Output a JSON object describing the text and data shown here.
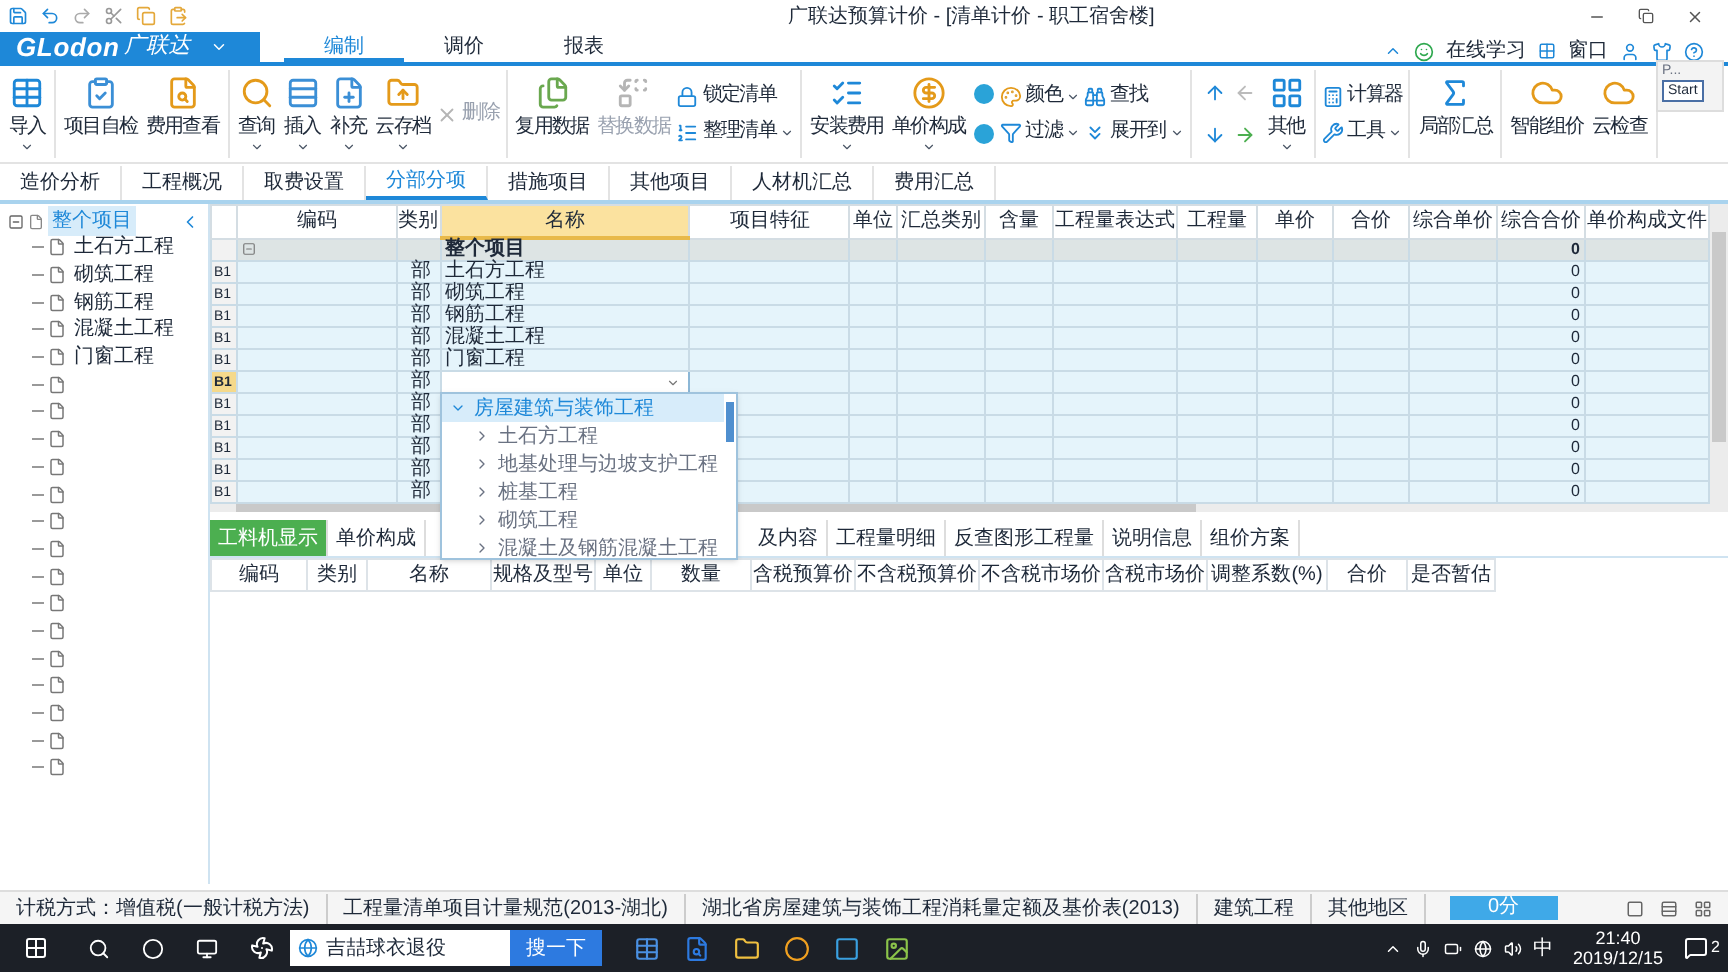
{
  "window": {
    "title": "广联达预算计价 - [清单计价 - 职工宿舍楼]"
  },
  "brand": {
    "logo": "GLodon",
    "name": "广联达"
  },
  "menu": [
    {
      "label": "编制",
      "selected": true
    },
    {
      "label": "调价",
      "selected": false
    },
    {
      "label": "报表",
      "selected": false
    }
  ],
  "help_links": [
    {
      "label": "在线学习"
    },
    {
      "label": "窗口"
    }
  ],
  "recorder": {
    "label": "P...",
    "button": "Start"
  },
  "ribbon": [
    {
      "items": [
        {
          "kind": "large",
          "label": "导入",
          "dropdown": true,
          "disabled": false
        }
      ]
    },
    {
      "items": [
        {
          "kind": "large",
          "label": "项目自检",
          "dropdown": false,
          "disabled": false
        },
        {
          "kind": "large",
          "label": "费用查看",
          "dropdown": false,
          "disabled": false
        }
      ]
    },
    {
      "items": [
        {
          "kind": "large",
          "label": "查询",
          "dropdown": true,
          "disabled": false
        },
        {
          "kind": "large",
          "label": "插入",
          "dropdown": true,
          "disabled": false
        },
        {
          "kind": "large",
          "label": "补充",
          "dropdown": true,
          "disabled": false
        },
        {
          "kind": "large",
          "label": "云存档",
          "dropdown": true,
          "disabled": false
        },
        {
          "kind": "small",
          "label": "删除",
          "dropdown": false,
          "disabled": true
        }
      ]
    },
    {
      "items": [
        {
          "kind": "large",
          "label": "复用数据",
          "dropdown": false,
          "disabled": false
        },
        {
          "kind": "large",
          "label": "替换数据",
          "dropdown": false,
          "disabled": true
        },
        {
          "kind": "small",
          "label": "锁定清单",
          "dropdown": false,
          "disabled": false
        },
        {
          "kind": "small",
          "label": "整理清单",
          "dropdown": true,
          "disabled": false
        }
      ]
    },
    {
      "items": [
        {
          "kind": "large",
          "label": "安装费用",
          "dropdown": true,
          "disabled": false
        },
        {
          "kind": "large",
          "label": "单价构成",
          "dropdown": true,
          "disabled": false
        },
        {
          "kind": "circles"
        },
        {
          "kind": "small",
          "label": "颜色",
          "dropdown": true,
          "disabled": false
        },
        {
          "kind": "small",
          "label": "过滤",
          "dropdown": true,
          "disabled": false
        },
        {
          "kind": "small",
          "label": "查找",
          "dropdown": false,
          "disabled": false
        },
        {
          "kind": "small",
          "label": "展开到",
          "dropdown": true,
          "disabled": false
        }
      ]
    },
    {
      "items": [
        {
          "kind": "arrows"
        },
        {
          "kind": "large",
          "label": "其他",
          "dropdown": true,
          "disabled": false
        }
      ]
    },
    {
      "items": [
        {
          "kind": "small",
          "label": "计算器",
          "dropdown": false,
          "disabled": false
        },
        {
          "kind": "small",
          "label": "工具",
          "dropdown": true,
          "disabled": false
        }
      ]
    },
    {
      "items": [
        {
          "kind": "large",
          "label": "局部汇总",
          "dropdown": false,
          "disabled": false
        }
      ]
    },
    {
      "items": [
        {
          "kind": "large",
          "label": "智能组价",
          "dropdown": false,
          "disabled": false
        },
        {
          "kind": "large",
          "label": "云检查",
          "dropdown": false,
          "disabled": false
        }
      ]
    }
  ],
  "view_tabs": [
    {
      "label": "造价分析",
      "selected": false
    },
    {
      "label": "工程概况",
      "selected": false
    },
    {
      "label": "取费设置",
      "selected": false
    },
    {
      "label": "分部分项",
      "selected": true
    },
    {
      "label": "措施项目",
      "selected": false
    },
    {
      "label": "其他项目",
      "selected": false
    },
    {
      "label": "人材机汇总",
      "selected": false
    },
    {
      "label": "费用汇总",
      "selected": false
    }
  ],
  "tree": {
    "label": "整个项目",
    "expanded": true,
    "selected": true,
    "children": [
      {
        "kind": "named",
        "label": "土石方工程"
      },
      {
        "kind": "named",
        "label": "砌筑工程"
      },
      {
        "kind": "named",
        "label": "钢筋工程"
      },
      {
        "kind": "named",
        "label": "混凝土工程"
      },
      {
        "kind": "named",
        "label": "门窗工程"
      },
      {
        "kind": "blank"
      },
      {
        "kind": "blank"
      },
      {
        "kind": "blank"
      },
      {
        "kind": "blank"
      },
      {
        "kind": "blank"
      },
      {
        "kind": "blank"
      },
      {
        "kind": "blank"
      },
      {
        "kind": "blank"
      },
      {
        "kind": "blank"
      },
      {
        "kind": "blank"
      },
      {
        "kind": "blank"
      },
      {
        "kind": "blank"
      },
      {
        "kind": "blank"
      },
      {
        "kind": "blank"
      },
      {
        "kind": "blank"
      }
    ]
  },
  "table": {
    "columns": [
      {
        "label": "编码",
        "selected": false
      },
      {
        "label": "类别",
        "selected": false
      },
      {
        "label": "名称",
        "selected": true
      },
      {
        "label": "项目特征",
        "selected": false
      },
      {
        "label": "单位",
        "selected": false
      },
      {
        "label": "汇总类别",
        "selected": false
      },
      {
        "label": "含量",
        "selected": false
      },
      {
        "label": "工程量表达式",
        "selected": false
      },
      {
        "label": "工程量",
        "selected": false
      },
      {
        "label": "单价",
        "selected": false
      },
      {
        "label": "合价",
        "selected": false
      },
      {
        "label": "综合单价",
        "selected": false
      },
      {
        "label": "综合合价",
        "selected": false
      },
      {
        "label": "单价构成文件",
        "selected": false
      }
    ],
    "rows": [
      {
        "kind": "summary",
        "name": "整个项目",
        "total": "0",
        "selected": false
      },
      {
        "kind": "part",
        "marker": "B1",
        "category": "部",
        "name": "土石方工程",
        "total": "0",
        "selected": false
      },
      {
        "kind": "part",
        "marker": "B1",
        "category": "部",
        "name": "砌筑工程",
        "total": "0",
        "selected": false
      },
      {
        "kind": "part",
        "marker": "B1",
        "category": "部",
        "name": "钢筋工程",
        "total": "0",
        "selected": false
      },
      {
        "kind": "part",
        "marker": "B1",
        "category": "部",
        "name": "混凝土工程",
        "total": "0",
        "selected": false
      },
      {
        "kind": "part",
        "marker": "B1",
        "category": "部",
        "name": "门窗工程",
        "total": "0",
        "selected": false
      },
      {
        "kind": "part",
        "marker": "B1",
        "category": "部",
        "total": "0",
        "selected": true
      },
      {
        "kind": "part",
        "marker": "B1",
        "category": "部",
        "total": "0",
        "selected": false
      },
      {
        "kind": "part",
        "marker": "B1",
        "category": "部",
        "total": "0",
        "selected": false
      },
      {
        "kind": "part",
        "marker": "B1",
        "category": "部",
        "total": "0",
        "selected": false
      },
      {
        "kind": "part",
        "marker": "B1",
        "category": "部",
        "total": "0",
        "selected": false
      },
      {
        "kind": "part",
        "marker": "B1",
        "category": "部",
        "total": "0",
        "selected": false
      }
    ]
  },
  "name_dropdown": {
    "items": [
      {
        "label": "房屋建筑与装饰工程",
        "expanded": true,
        "selected": true,
        "children": [
          {
            "label": "土石方工程",
            "expanded": false
          },
          {
            "label": "地基处理与边坡支护工程",
            "expanded": false
          },
          {
            "label": "桩基工程",
            "expanded": false
          },
          {
            "label": "砌筑工程",
            "expanded": false
          },
          {
            "label": "混凝土及钢筋混凝土工程",
            "expanded": false
          }
        ]
      }
    ]
  },
  "bottom_tabs": [
    {
      "label": "工料机显示",
      "selected": true
    },
    {
      "label": "单价构成",
      "selected": false
    },
    {
      "kind": "covered",
      "label": "及内容",
      "selected": false
    },
    {
      "label": "工程量明细",
      "selected": false
    },
    {
      "label": "反查图形工程量",
      "selected": false
    },
    {
      "label": "说明信息",
      "selected": false
    },
    {
      "label": "组价方案",
      "selected": false
    }
  ],
  "bottom_table": {
    "columns": [
      "编码",
      "类别",
      "名称",
      "规格及型号",
      "单位",
      "数量",
      "含税预算价",
      "不含税预算价",
      "不含税市场价",
      "含税市场价",
      "调整系数(%)",
      "合价",
      "是否暂估"
    ]
  },
  "status_bar": {
    "items": [
      "计税方式：增值税(一般计税方法)",
      "工程量清单项目计量规范(2013-湖北)",
      "湖北省房屋建筑与装饰工程消耗量定额及基价表(2013)",
      "建筑工程",
      "其他地区"
    ],
    "score": "0分"
  },
  "taskbar": {
    "search_text": "吉喆球衣退役",
    "search_button": "搜一下",
    "ime": "中",
    "time": "21:40",
    "date": "2019/12/15",
    "notifications": "2"
  }
}
